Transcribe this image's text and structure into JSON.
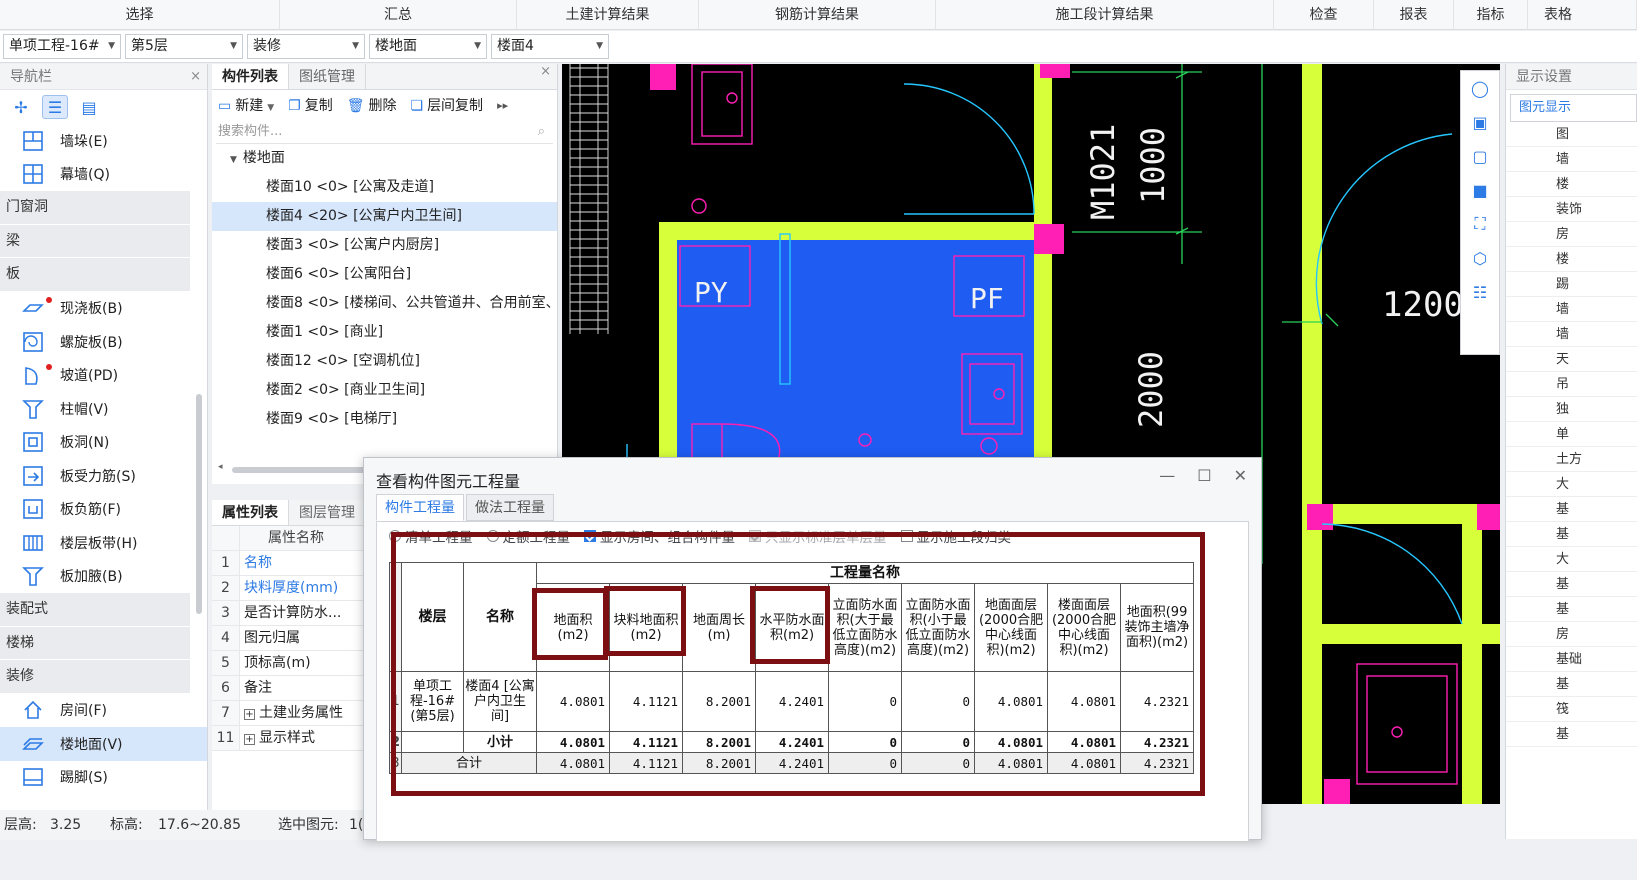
{
  "ribbon": {
    "tabs": [
      "选择",
      "汇总",
      "土建计算结果",
      "钢筋计算结果",
      "施工段计算结果",
      "检查",
      "报表",
      "指标",
      "表格"
    ]
  },
  "selectors": [
    {
      "value": "单项工程-16#"
    },
    {
      "value": "第5层"
    },
    {
      "value": "装修"
    },
    {
      "value": "楼地面"
    },
    {
      "value": "楼面4"
    }
  ],
  "nav": {
    "title": "导航栏",
    "close": "×",
    "items_top": [
      {
        "label": "墙垛(E)"
      },
      {
        "label": "幕墙(Q)"
      }
    ],
    "cat_door": "门窗洞",
    "cat_beam": "梁",
    "cat_slab": "板",
    "slab_items": [
      {
        "label": "现浇板(B)"
      },
      {
        "label": "螺旋板(B)"
      },
      {
        "label": "坡道(PD)"
      },
      {
        "label": "柱帽(V)"
      },
      {
        "label": "板洞(N)"
      },
      {
        "label": "板受力筋(S)"
      },
      {
        "label": "板负筋(F)"
      },
      {
        "label": "楼层板带(H)"
      },
      {
        "label": "板加腋(B)"
      }
    ],
    "cat_prefab": "装配式",
    "cat_stair": "楼梯",
    "cat_deco": "装修",
    "deco_items": [
      {
        "label": "房间(F)"
      },
      {
        "label": "楼地面(V)"
      },
      {
        "label": "踢脚(S)"
      }
    ]
  },
  "comp": {
    "tab_list": "构件列表",
    "tab_drawing": "图纸管理",
    "tools": {
      "new": "新建",
      "copy": "复制",
      "delete": "删除",
      "floor_copy": "层间复制"
    },
    "search_placeholder": "搜索构件...",
    "root": "楼地面",
    "items": [
      "楼面10 <0> [公寓及走道]",
      "楼面4 <20> [公寓户内卫生间]",
      "楼面3 <0> [公寓户内厨房]",
      "楼面6 <0> [公寓阳台]",
      "楼面8 <0> [楼梯间、公共管道井、合用前室、",
      "楼面1 <0> [商业]",
      "楼面12 <0> [空调机位]",
      "楼面2 <0> [商业卫生间]",
      "楼面9 <0> [电梯厅]"
    ]
  },
  "prop": {
    "tab_attr": "属性列表",
    "tab_layer": "图层管理",
    "header": "属性名称",
    "rows": [
      {
        "num": "1",
        "name": "名称"
      },
      {
        "num": "2",
        "name": "块料厚度(mm)"
      },
      {
        "num": "3",
        "name": "是否计算防水..."
      },
      {
        "num": "4",
        "name": "图元归属"
      },
      {
        "num": "5",
        "name": "顶标高(m)"
      },
      {
        "num": "6",
        "name": "备注"
      },
      {
        "num": "7",
        "name": "土建业务属性"
      },
      {
        "num": "11",
        "name": "显示样式"
      }
    ]
  },
  "cad": {
    "labels": {
      "py": "PY",
      "pf": "PF",
      "m1021": "M1021",
      "d1000": "1000",
      "d1200": "1200",
      "d2000": "2000"
    }
  },
  "display": {
    "title": "显示设置",
    "tab": "图元显示",
    "rows": [
      "图",
      "墙",
      "楼",
      "装饰",
      "房",
      "楼",
      "踢",
      "墙",
      "墙",
      "天",
      "吊",
      "独",
      "单",
      "土方",
      "大",
      "基",
      "基",
      "大",
      "基",
      "基",
      "房",
      "基础",
      "基",
      "筏",
      "基"
    ]
  },
  "status": {
    "floor_height_label": "层高:",
    "floor_height": "3.25",
    "elev_label": "标高:",
    "elev": "17.6~20.85",
    "selected_label": "选中图元:",
    "selected": "1("
  },
  "dialog": {
    "title": "查看构件图元工程量",
    "tab_comp": "构件工程量",
    "tab_method": "做法工程量",
    "options": {
      "list_qty": "清单工程量",
      "quota_qty": "定额工程量",
      "show_room": "显示房间、组合构件量",
      "only_std": "只显示标准层单层量",
      "show_section": "显示施工段归类"
    },
    "table": {
      "col_floor": "楼层",
      "col_name": "名称",
      "group_header": "工程量名称",
      "columns": [
        "地面积(m2)",
        "块料地面积(m2)",
        "地面周长(m)",
        "水平防水面积(m2)",
        "立面防水面积(大于最低立面防水高度)(m2)",
        "立面防水面积(小于最低立面防水高度)(m2)",
        "地面面层(2000合肥中心线面积)(m2)",
        "楼面面层(2000合肥中心线面积)(m2)",
        "地面积(99装饰主墙净面积)(m2)"
      ],
      "row1": {
        "rn": "1",
        "floor": "单项工程-16#(第5层)",
        "name": "楼面4 [公寓户内卫生间]",
        "values": [
          "4.0801",
          "4.1121",
          "8.2001",
          "4.2401",
          "0",
          "0",
          "4.0801",
          "4.0801",
          "4.2321"
        ]
      },
      "row2": {
        "rn": "2",
        "label": "小计",
        "values": [
          "4.0801",
          "4.1121",
          "8.2001",
          "4.2401",
          "0",
          "0",
          "4.0801",
          "4.0801",
          "4.2321"
        ]
      },
      "row3": {
        "rn": "3",
        "label": "合计",
        "values": [
          "4.0801",
          "4.1121",
          "8.2001",
          "4.2401",
          "0",
          "0",
          "4.0801",
          "4.0801",
          "4.2321"
        ]
      }
    }
  },
  "colors": {
    "accent": "#2d7be5",
    "highlight_box": "#7b0f12",
    "cad_wall": "#d7ff3a",
    "cad_floor": "#1f5cf2",
    "cad_magenta": "#ff1fb4",
    "cad_cyan": "#26c6ff"
  }
}
